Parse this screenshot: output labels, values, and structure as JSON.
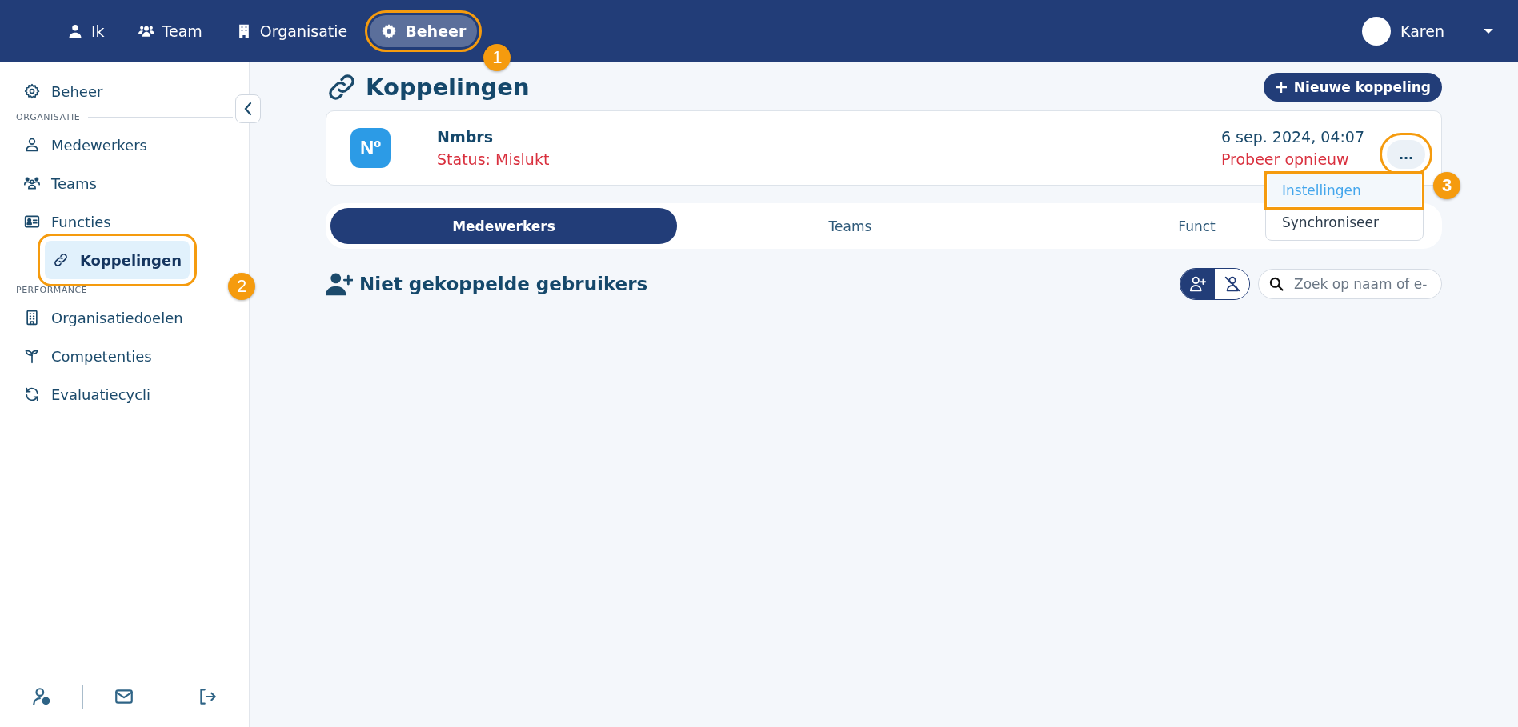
{
  "top_nav": {
    "items": [
      {
        "label": "Ik",
        "selected": false
      },
      {
        "label": "Team",
        "selected": false
      },
      {
        "label": "Organisatie",
        "selected": false
      },
      {
        "label": "Beheer",
        "selected": true,
        "callout": "1"
      }
    ],
    "user": {
      "name": "Karen"
    }
  },
  "sidebar": {
    "top_item": {
      "label": "Beheer",
      "selected": false
    },
    "sections": [
      {
        "title": "ORGANISATIE",
        "items": [
          {
            "label": "Medewerkers",
            "selected": false
          },
          {
            "label": "Teams",
            "selected": false
          },
          {
            "label": "Functies",
            "selected": false
          },
          {
            "label": "Koppelingen",
            "selected": true,
            "callout": "2"
          }
        ]
      },
      {
        "title": "PERFORMANCE",
        "items": [
          {
            "label": "Organisatiedoelen",
            "selected": false
          },
          {
            "label": "Competenties",
            "selected": false
          },
          {
            "label": "Evaluatiecycli",
            "selected": false
          }
        ]
      }
    ]
  },
  "page": {
    "title": "Koppelingen",
    "new_button": "Nieuwe koppeling",
    "integration": {
      "logo_text": "Nº",
      "name": "Nmbrs",
      "status": "Status: Mislukt",
      "date": "6 sep. 2024, 04:07",
      "retry_link": "Probeer opnieuw",
      "more_button": {
        "label": "...",
        "callout": "3"
      },
      "menu": [
        {
          "label": "Instellingen",
          "selected": true,
          "outlined": true
        },
        {
          "label": "Synchroniseer",
          "selected": false,
          "outlined": false
        }
      ]
    },
    "tabs": [
      {
        "label": "Medewerkers",
        "selected": true
      },
      {
        "label": "Teams",
        "selected": false
      },
      {
        "label": "Funct",
        "selected": false
      }
    ],
    "section": {
      "title": "Niet gekoppelde gebruikers",
      "filter_toggle": [
        {
          "selected": true
        },
        {
          "selected": false
        }
      ],
      "search": {
        "placeholder": "Zoek op naam of e-"
      }
    }
  }
}
